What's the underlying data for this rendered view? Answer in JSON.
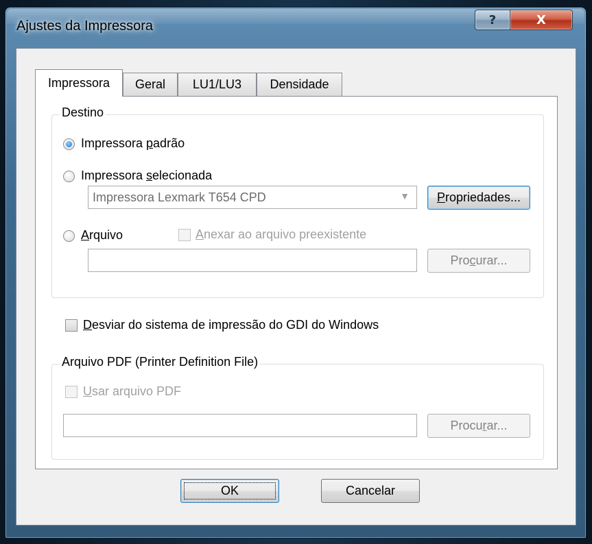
{
  "window": {
    "title": "Ajustes da Impressora",
    "help_label": "?",
    "close_label": "X"
  },
  "tabs": [
    {
      "label": "Impressora",
      "active": true
    },
    {
      "label": "Geral",
      "active": false
    },
    {
      "label": "LU1/LU3",
      "active": false
    },
    {
      "label": "Densidade",
      "active": false
    }
  ],
  "destino": {
    "group_label": "Destino",
    "radio_default": {
      "pre": "Impressora ",
      "key": "p",
      "post": "adrão",
      "checked": true
    },
    "radio_selected": {
      "pre": "Impressora ",
      "key": "s",
      "post": "elecionada",
      "checked": false
    },
    "printer_combo": {
      "value": "Impressora Lexmark T654 CPD",
      "enabled": false
    },
    "properties_button": {
      "key": "P",
      "post": "ropriedades..."
    },
    "radio_file": {
      "key": "A",
      "post": "rquivo",
      "checked": false
    },
    "append_checkbox": {
      "key": "A",
      "post": "nexar ao arquivo preexistente",
      "checked": false,
      "enabled": false
    },
    "file_path": {
      "value": "",
      "enabled": false
    },
    "browse_button": {
      "pre": "Pro",
      "key": "c",
      "post": "urar...",
      "enabled": false
    }
  },
  "bypass_gdi": {
    "key": "D",
    "post": "esviar do sistema de impressão do GDI do Windows",
    "checked": false
  },
  "pdf": {
    "group_label": "Arquivo PDF (Printer Definition File)",
    "use_checkbox": {
      "key": "U",
      "post": "sar arquivo PDF",
      "checked": false,
      "enabled": false
    },
    "pdf_path": {
      "value": "",
      "enabled": false
    },
    "browse_button": {
      "pre": "Procu",
      "key": "r",
      "post": "ar...",
      "enabled": false
    }
  },
  "footer": {
    "ok_label": "OK",
    "cancel_label": "Cancelar"
  }
}
